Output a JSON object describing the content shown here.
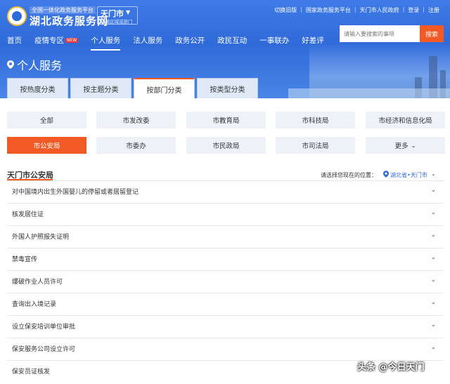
{
  "header": {
    "site_subtitle": "全国一体化政务服务平台",
    "site_title": "湖北政务服务网",
    "city": "天门市",
    "city_sub": "切换区域或部门",
    "top_links": [
      "切换旧版",
      "国家政务服务平台",
      "天门市人民政府",
      "登录",
      "注册"
    ],
    "nav": [
      {
        "label": "首页",
        "badge": ""
      },
      {
        "label": "疫情专区",
        "badge": "NEW"
      },
      {
        "label": "个人服务",
        "badge": ""
      },
      {
        "label": "法人服务",
        "badge": ""
      },
      {
        "label": "政务公开",
        "badge": ""
      },
      {
        "label": "政民互动",
        "badge": ""
      },
      {
        "label": "一事联办",
        "badge": ""
      },
      {
        "label": "好差评",
        "badge": ""
      }
    ],
    "active_nav": "个人服务",
    "search_placeholder": "请输入要搜索的事项",
    "search_button": "搜索"
  },
  "page": {
    "title": "个人服务",
    "tabs": [
      "按热度分类",
      "按主题分类",
      "按部门分类",
      "按类型分类"
    ],
    "active_tab": "按部门分类"
  },
  "departments": [
    "全部",
    "市发改委",
    "市教育局",
    "市科技局",
    "市经济和信息化局",
    "市公安局",
    "市委办",
    "市民政局",
    "市司法局",
    "更多"
  ],
  "active_department": "市公安局",
  "section": {
    "title": "天门市公安局",
    "location_label": "请选择您现在的位置：",
    "location_value": "湖北省•天门市"
  },
  "services": [
    "对中国境内出生外国婴儿的停留或者居留登记",
    "核发居住证",
    "外国人护照报失证明",
    "禁毒宣传",
    "爆破作业人员许可",
    "查询出入境记录",
    "设立保安培训单位审批",
    "保安服务公司设立许可",
    "保安员证核发"
  ],
  "watermark": "头条 @今日天门",
  "colors": {
    "brand_blue": "#2f6ad9",
    "accent_orange": "#f25a25",
    "chip_bg": "#eef2f8"
  }
}
